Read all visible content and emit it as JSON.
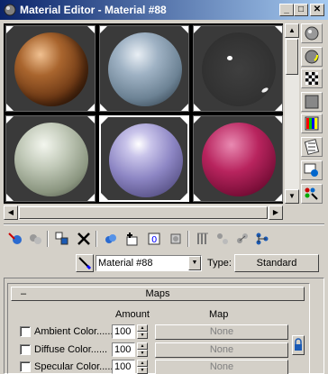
{
  "window": {
    "title": "Material Editor - Material #88",
    "minimize": "_",
    "maximize": "□",
    "close": "✕"
  },
  "sample_slots": [
    {
      "material": "wood",
      "active": false
    },
    {
      "material": "checker-reflective",
      "active": false
    },
    {
      "material": "dark-glossy",
      "active": false
    },
    {
      "material": "gray-green",
      "active": false
    },
    {
      "material": "lavender",
      "active": true
    },
    {
      "material": "magenta",
      "active": false
    }
  ],
  "side_tools": [
    "sample-type-icon",
    "backlight-icon",
    "background-icon",
    "uv-tiling-icon",
    "video-color-check-icon",
    "make-preview-icon",
    "options-icon",
    "select-by-material-icon"
  ],
  "toolbar_tools": [
    "get-material-icon",
    "put-to-scene-icon",
    "assign-material-icon",
    "reset-map-icon",
    "make-copy-icon",
    "make-unique-icon",
    "put-to-library-icon",
    "material-effects-channel-icon",
    "show-map-in-viewport-icon",
    "show-end-result-icon",
    "go-to-parent-icon",
    "go-forward-to-sibling-icon",
    "material-map-navigator-icon"
  ],
  "material": {
    "name": "Material #88",
    "type_label": "Type:",
    "type_value": "Standard"
  },
  "maps_rollout": {
    "toggle": "–",
    "title": "Maps",
    "col_amount": "Amount",
    "col_map": "Map",
    "rows": [
      {
        "label": "Ambient Color......",
        "amount": "100",
        "map": "None"
      },
      {
        "label": "Diffuse Color......",
        "amount": "100",
        "map": "None"
      },
      {
        "label": "Specular Color......",
        "amount": "100",
        "map": "None"
      }
    ]
  }
}
